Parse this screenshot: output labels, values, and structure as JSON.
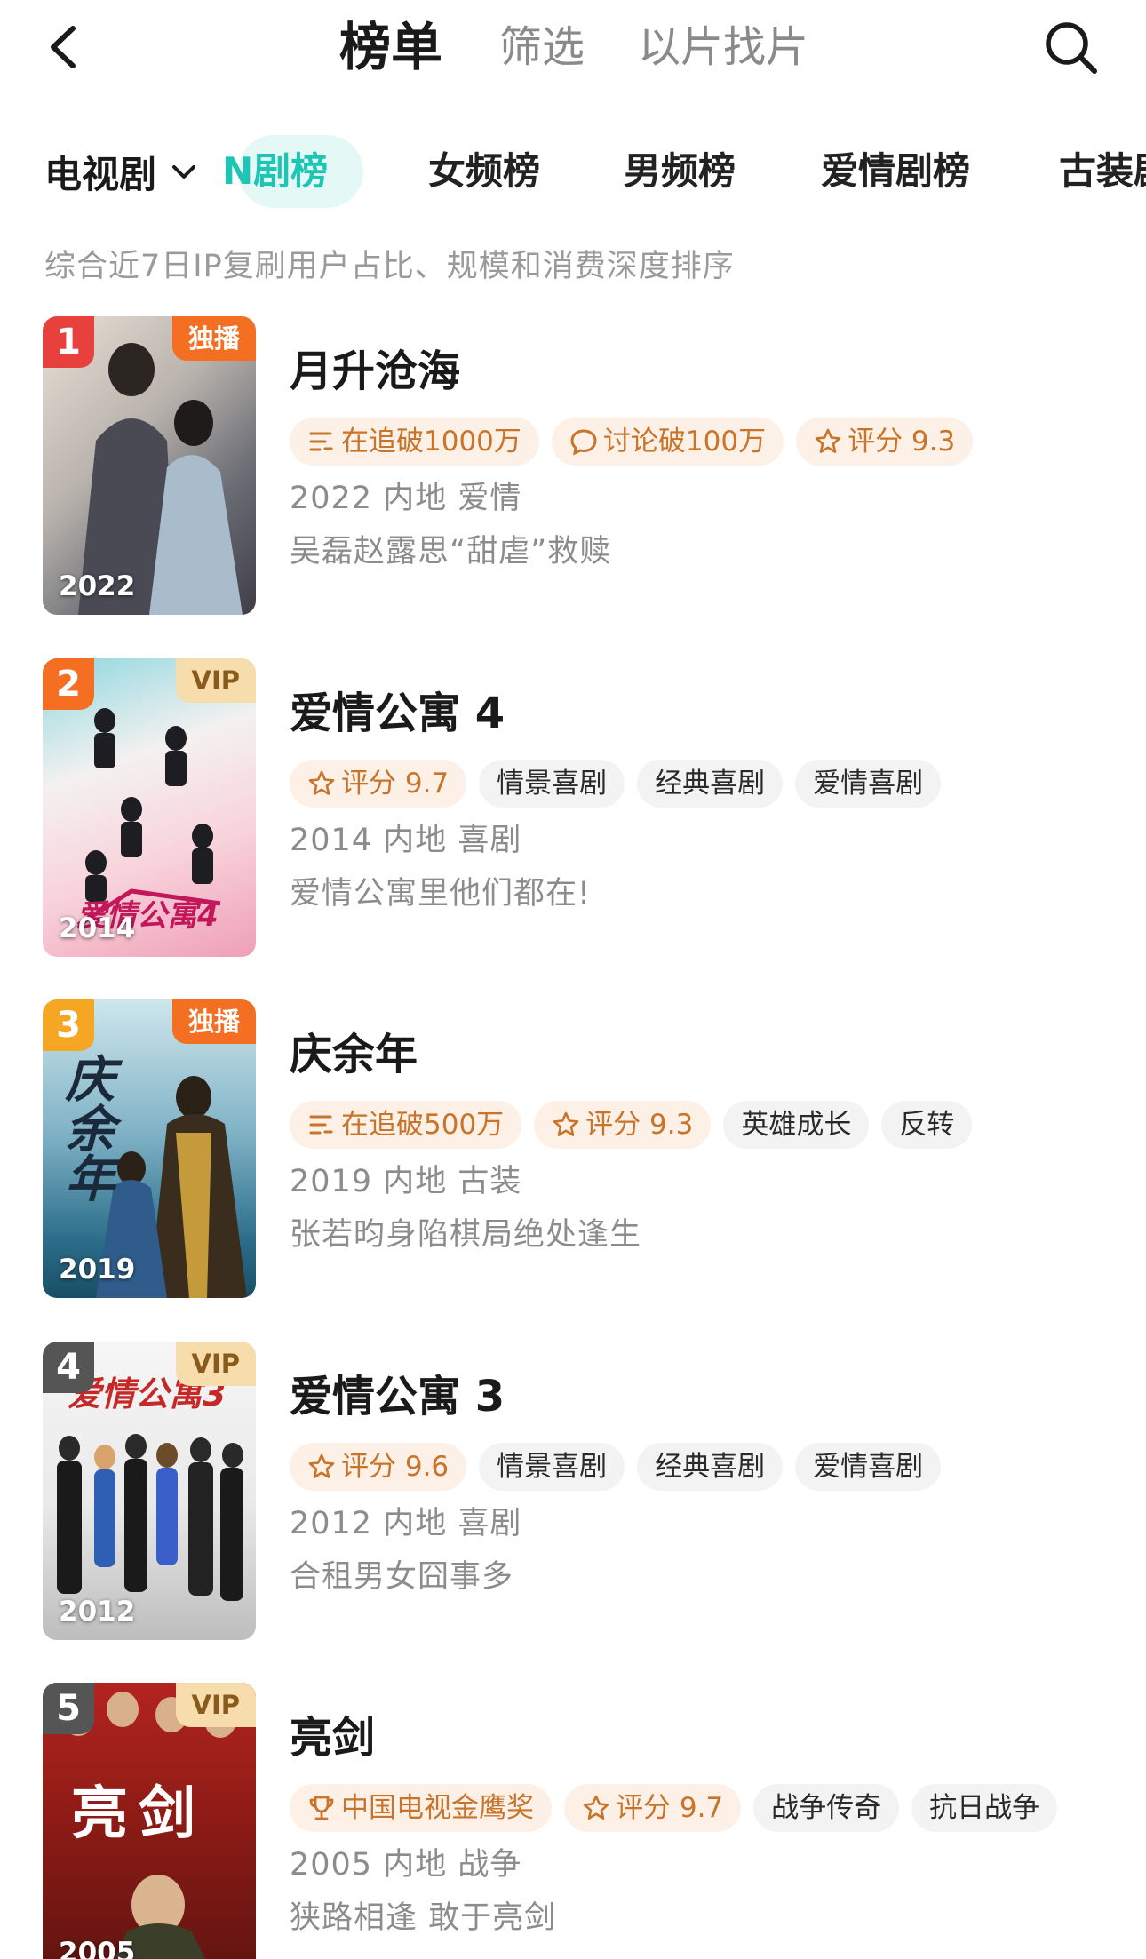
{
  "header": {
    "tabs": [
      {
        "label": "榜单",
        "active": true
      },
      {
        "label": "筛选",
        "active": false
      },
      {
        "label": "以片找片",
        "active": false
      }
    ]
  },
  "category": {
    "dropdown_label": "电视剧",
    "chips": [
      {
        "label": "N剧榜",
        "active": true
      },
      {
        "label": "女频榜",
        "active": false
      },
      {
        "label": "男频榜",
        "active": false
      },
      {
        "label": "爱情剧榜",
        "active": false
      },
      {
        "label": "古装剧榜",
        "active": false
      }
    ]
  },
  "description": "综合近7日IP复刷用户占比、规模和消费深度排序",
  "colors": {
    "accent_teal": "#1dc6b4",
    "rank1": "#e8403c",
    "rank2": "#f56f22",
    "rank3": "#f5a623",
    "rank_other": "#555555",
    "exclusive_badge": "#f56f22",
    "vip_badge": "#f7ddac",
    "hot_tag_text": "#c8742a"
  },
  "items": [
    {
      "rank": "1",
      "badge": "独播",
      "badge_type": "exclusive",
      "poster_year": "2022",
      "title": "月升沧海",
      "tags": [
        {
          "icon": "list-icon",
          "text": "在追破1000万",
          "style": "hot"
        },
        {
          "icon": "comment-icon",
          "text": "讨论破100万",
          "style": "hot"
        },
        {
          "icon": "star-icon",
          "text": "评分 9.3",
          "style": "hot"
        }
      ],
      "meta": "2022 内地 爱情",
      "slogan": "吴磊赵露思“甜虐”救赎"
    },
    {
      "rank": "2",
      "badge": "VIP",
      "badge_type": "vip",
      "poster_year": "2014",
      "title": "爱情公寓 4",
      "tags": [
        {
          "icon": "star-icon",
          "text": "评分 9.7",
          "style": "hot"
        },
        {
          "icon": "",
          "text": "情景喜剧",
          "style": "plain"
        },
        {
          "icon": "",
          "text": "经典喜剧",
          "style": "plain"
        },
        {
          "icon": "",
          "text": "爱情喜剧",
          "style": "plain"
        }
      ],
      "meta": "2014 内地 喜剧",
      "slogan": "爱情公寓里他们都在!"
    },
    {
      "rank": "3",
      "badge": "独播",
      "badge_type": "exclusive",
      "poster_year": "2019",
      "title": "庆余年",
      "tags": [
        {
          "icon": "list-icon",
          "text": "在追破500万",
          "style": "hot"
        },
        {
          "icon": "star-icon",
          "text": "评分 9.3",
          "style": "hot"
        },
        {
          "icon": "",
          "text": "英雄成长",
          "style": "plain"
        },
        {
          "icon": "",
          "text": "反转",
          "style": "plain"
        }
      ],
      "meta": "2019 内地 古装",
      "slogan": "张若昀身陷棋局绝处逢生"
    },
    {
      "rank": "4",
      "badge": "VIP",
      "badge_type": "vip",
      "poster_year": "2012",
      "title": "爱情公寓 3",
      "tags": [
        {
          "icon": "star-icon",
          "text": "评分 9.6",
          "style": "hot"
        },
        {
          "icon": "",
          "text": "情景喜剧",
          "style": "plain"
        },
        {
          "icon": "",
          "text": "经典喜剧",
          "style": "plain"
        },
        {
          "icon": "",
          "text": "爱情喜剧",
          "style": "plain"
        }
      ],
      "meta": "2012 内地 喜剧",
      "slogan": "合租男女囧事多"
    },
    {
      "rank": "5",
      "badge": "VIP",
      "badge_type": "vip",
      "poster_year": "2005",
      "title": "亮剑",
      "tags": [
        {
          "icon": "trophy-icon",
          "text": "中国电视金鹰奖",
          "style": "hot"
        },
        {
          "icon": "star-icon",
          "text": "评分 9.7",
          "style": "hot"
        },
        {
          "icon": "",
          "text": "战争传奇",
          "style": "plain"
        },
        {
          "icon": "",
          "text": "抗日战争",
          "style": "plain"
        }
      ],
      "meta": "2005 内地 战争",
      "slogan": "狭路相逢 敢于亮剑"
    }
  ]
}
